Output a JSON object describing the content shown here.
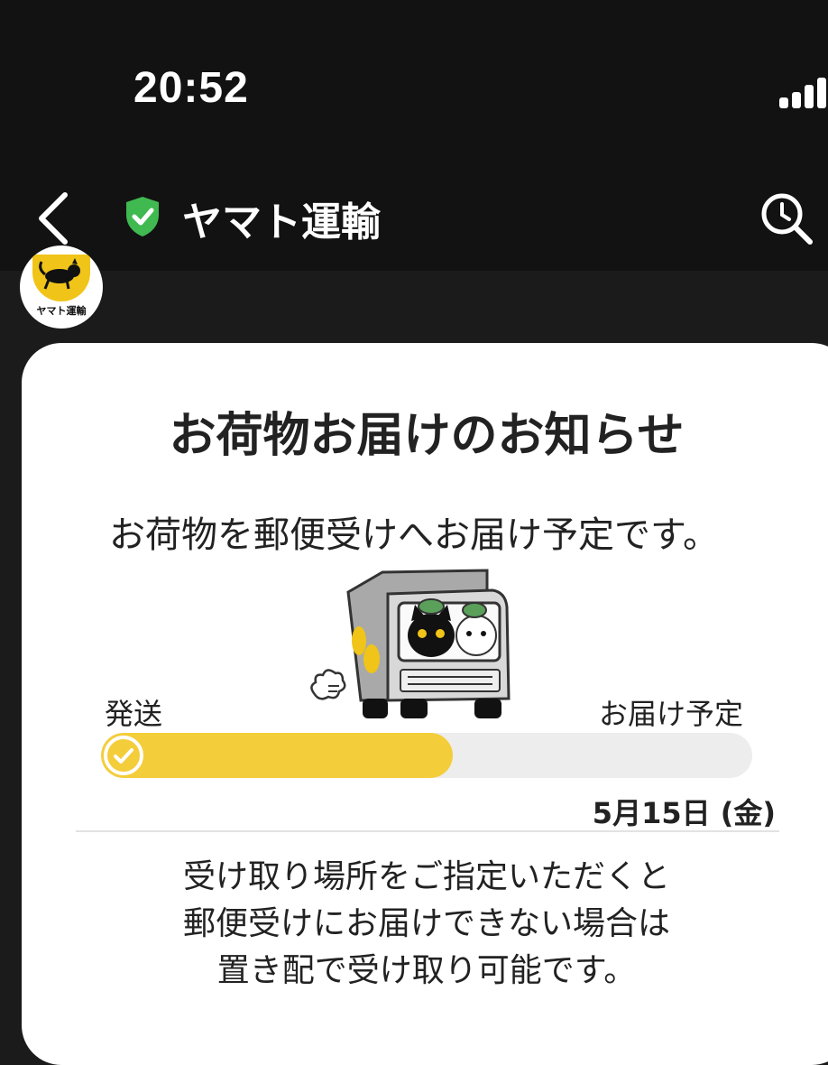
{
  "status_bar": {
    "time": "20:52"
  },
  "nav": {
    "title": "ヤマト運輸",
    "verified": true
  },
  "avatar": {
    "logo_text": "ヤマト運輸"
  },
  "card": {
    "title": "お荷物お届けのお知らせ",
    "subtitle": "お荷物を郵便受けへお届け予定です。",
    "progress": {
      "start_label": "発送",
      "end_label": "お届け予定",
      "fraction": 0.54,
      "date": "5月15日 (金)"
    },
    "notice_lines": [
      "受け取り場所をご指定いただくと",
      "郵便受けにお届けできない場合は",
      "置き配で受け取り可能です。"
    ]
  },
  "colors": {
    "accent_yellow": "#f4cd3b",
    "verified_green": "#3fb950",
    "header_bg": "#121212"
  }
}
